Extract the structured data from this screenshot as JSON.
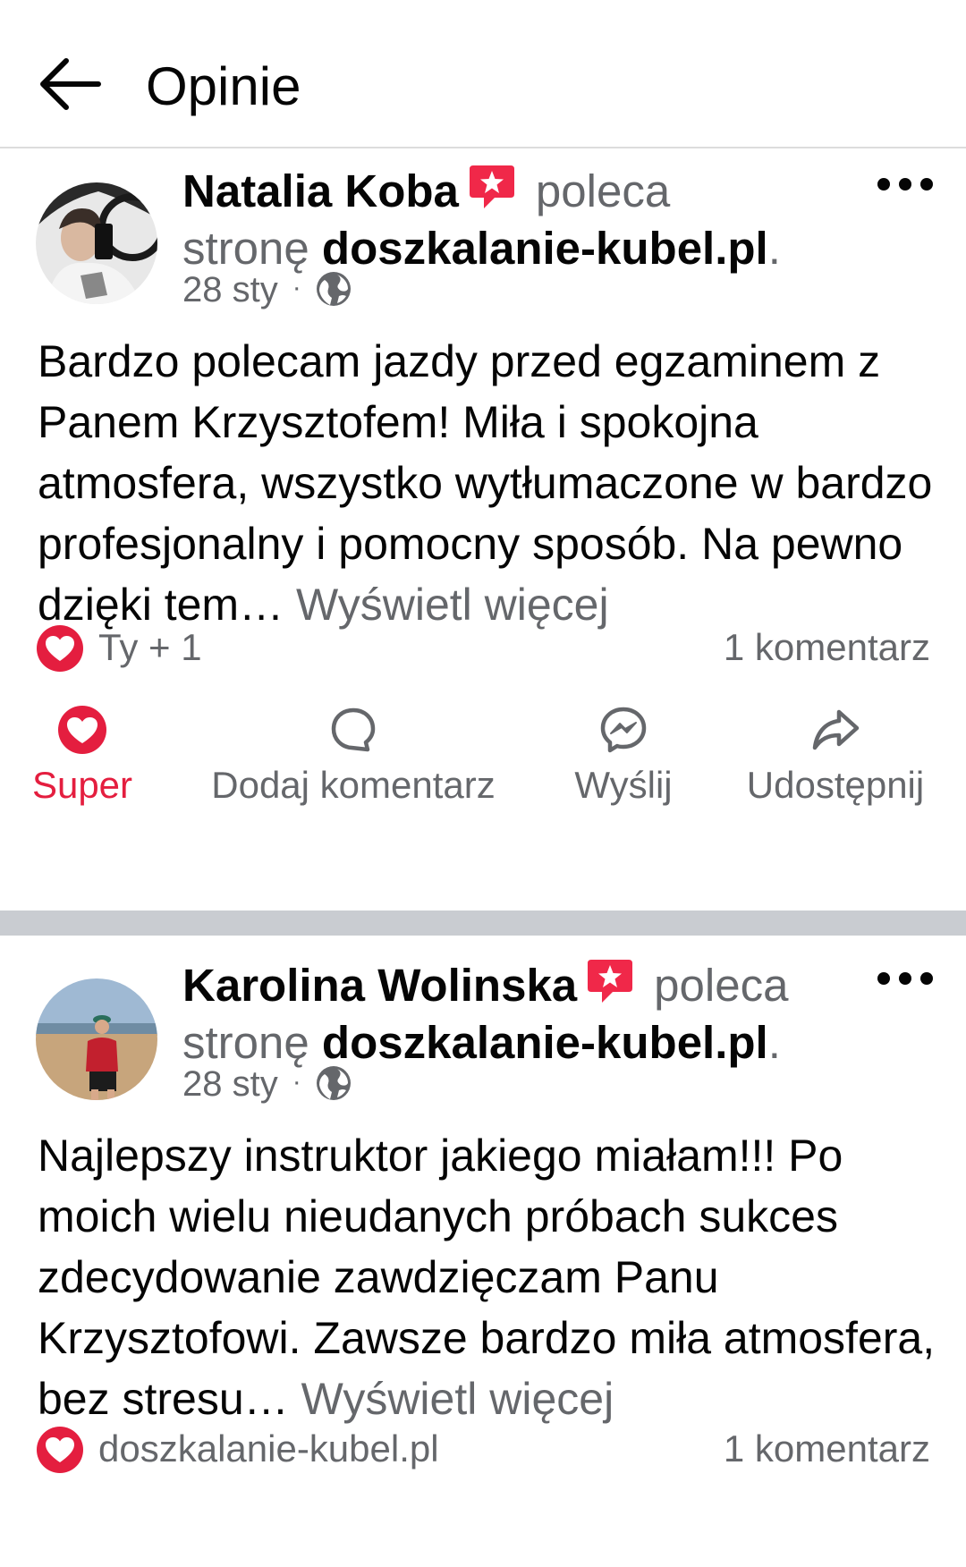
{
  "header": {
    "title": "Opinie",
    "back_icon": "arrow-left-icon"
  },
  "posts": [
    {
      "author": "Natalia Koba",
      "action_text": "poleca",
      "page_prefix": "stronę",
      "page_name": "doszkalanie-kubel.pl",
      "page_suffix": ".",
      "date": "28 sty",
      "dot": "·",
      "body": "Bardzo polecam jazdy przed egzaminem z Panem Krzysztofem! Miła i spokojna atmosfera, wszystko wytłumaczone w bardzo profesjonalny i pomocny sposób. Na pewno dzięki tem… ",
      "see_more": "Wyświetl więcej",
      "reactions": "Ty + 1",
      "comments": "1 komentarz"
    },
    {
      "author": "Karolina Wolinska",
      "action_text": "poleca",
      "page_prefix": "stronę",
      "page_name": "doszkalanie-kubel.pl",
      "page_suffix": ".",
      "date": "28 sty",
      "dot": "·",
      "body": "Najlepszy instruktor jakiego miałam!!! Po moich wielu nieudanych próbach sukces zdecydowanie zawdzięczam Panu Krzysztofowi. Zawsze bardzo miła atmosfera, bez stresu… ",
      "see_more": "Wyświetl więcej",
      "reactions": "doszkalanie-kubel.pl",
      "comments": "1 komentarz"
    }
  ],
  "actions": {
    "super": "Super",
    "comment": "Dodaj komentarz",
    "send": "Wyślij",
    "share": "Udostępnij"
  },
  "colors": {
    "heart": "#e41e3f",
    "badge": "#f02849",
    "secondary_text": "#65676b",
    "separator": "#c9ccd1"
  }
}
